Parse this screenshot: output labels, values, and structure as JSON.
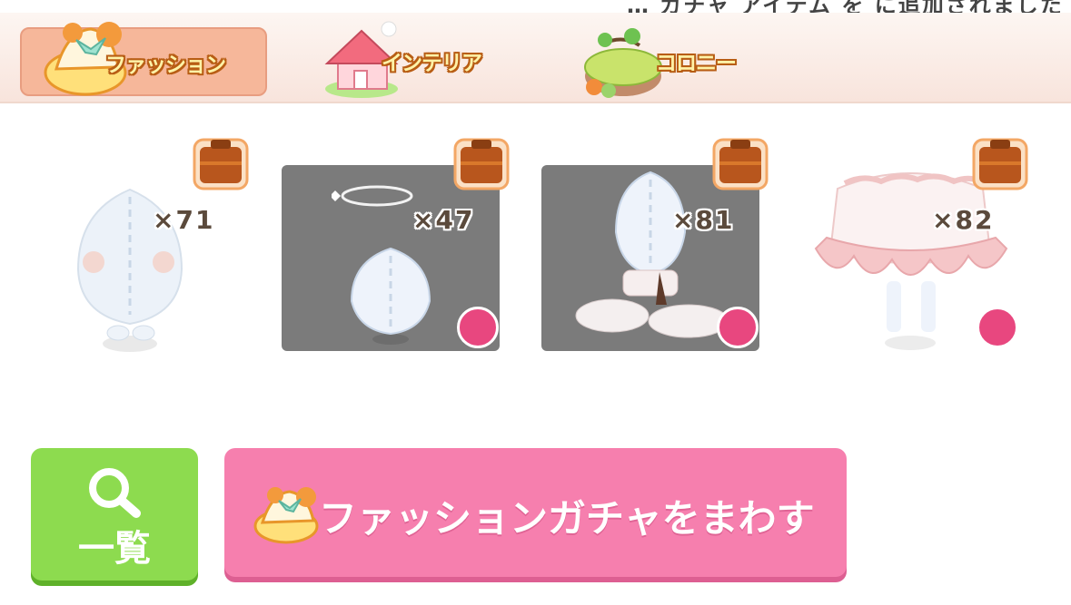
{
  "header": {
    "cutoff_text": "… ガチャ アイテム を に追加されました"
  },
  "tabs": [
    {
      "label": "ファッション",
      "active": true,
      "icon": "fashion-dress-icon"
    },
    {
      "label": "インテリア",
      "active": false,
      "icon": "house-icon"
    },
    {
      "label": "コロニー",
      "active": false,
      "icon": "colony-island-icon"
    }
  ],
  "items": [
    {
      "count": "×71",
      "selected": false,
      "icon": "bag-icon"
    },
    {
      "count": "×47",
      "selected": true,
      "icon": "bag-icon"
    },
    {
      "count": "×81",
      "selected": true,
      "icon": "bag-icon"
    },
    {
      "count": "×82",
      "selected": false,
      "icon": "bag-icon"
    }
  ],
  "buttons": {
    "list_label": "一覧",
    "gacha_label": "ファッションガチャをまわす"
  },
  "colors": {
    "tab_active": "#f6b79a",
    "list_button": "#8ddb4f",
    "gacha_button": "#f67fae",
    "dropper": "#e8477f"
  }
}
